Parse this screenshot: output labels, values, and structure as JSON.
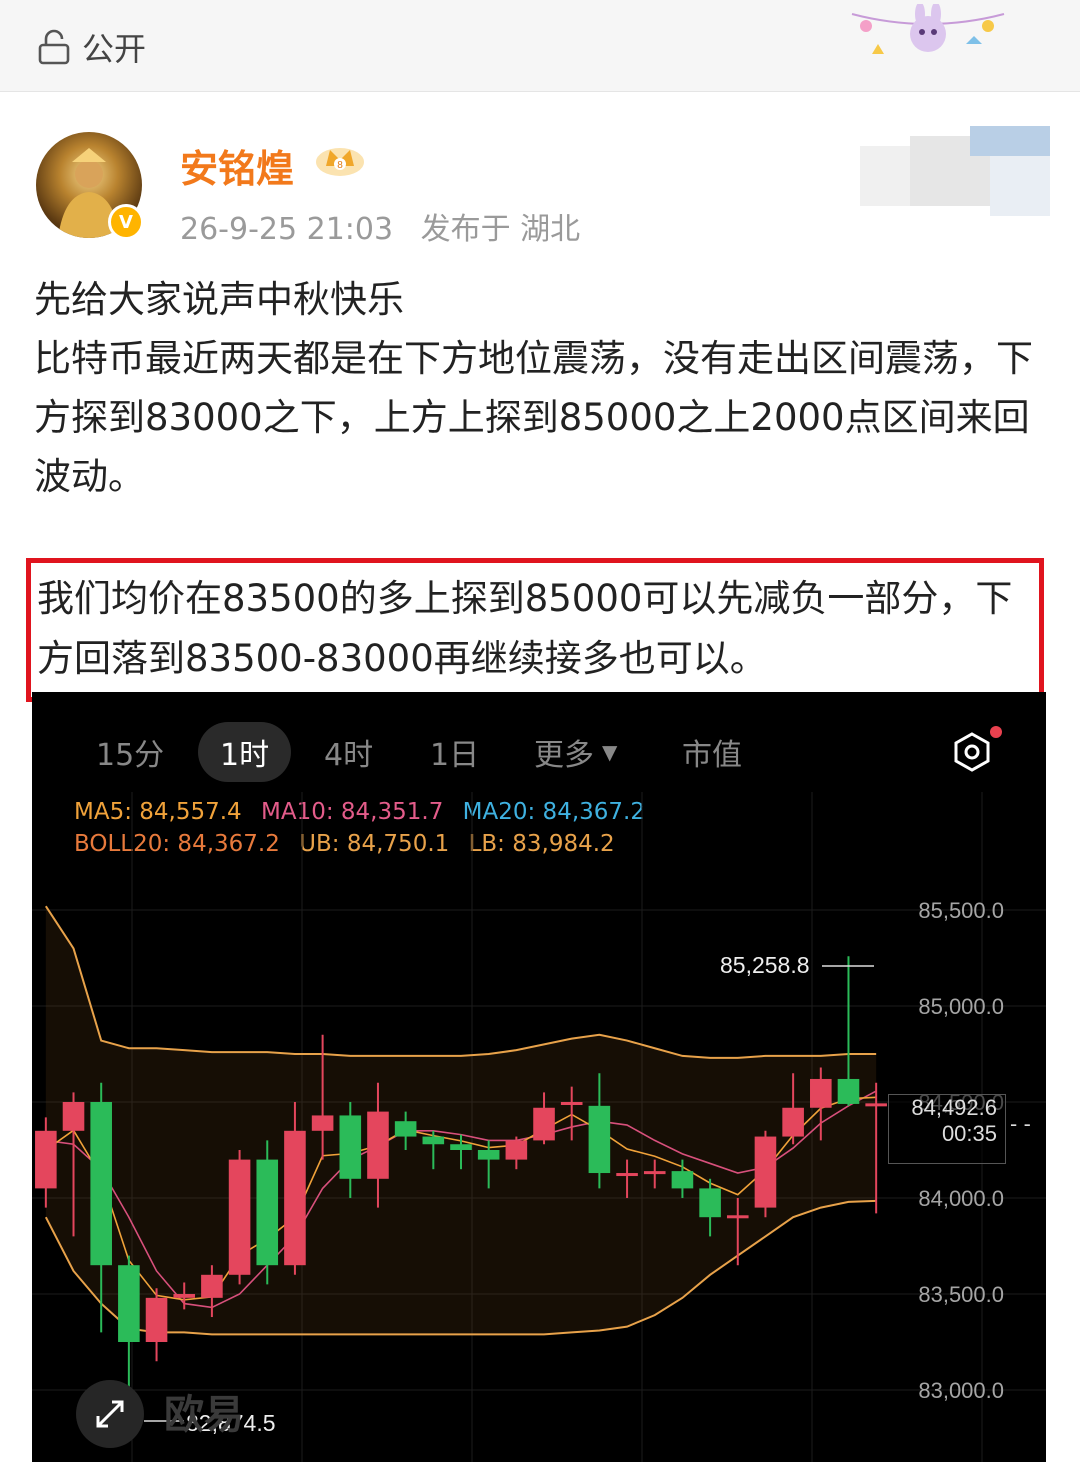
{
  "topbar": {
    "privacy_label": "公开"
  },
  "post": {
    "author": "安铭煌",
    "time": "26-9-25 21:03",
    "location": "发布于 湖北",
    "paragraphs": [
      "先给大家说声中秋快乐",
      "比特币最近两天都是在下方地位震荡，没有走出区间震荡，下方探到83000之下，上方上探到85000之上2000点区间来回波动。"
    ],
    "highlight": "我们均价在83500的多上探到85000可以先减负一部分，下方回落到83500-83000再继续接多也可以。"
  },
  "chart": {
    "tabs": [
      "15分",
      "1时",
      "4时",
      "1日",
      "更多",
      "市值"
    ],
    "active_tab": "1时",
    "indicators": {
      "ma5": "MA5: 84,557.4",
      "ma10": "MA10: 84,351.7",
      "ma20": "MA20: 84,367.2",
      "boll": "BOLL20: 84,367.2",
      "ub": "UB: 84,750.1",
      "lb": "LB: 83,984.2"
    },
    "high_label": "85,258.8",
    "low_label": "82,874.5",
    "current_price": "84,492.6",
    "countdown": "00:35",
    "watermark": "欧易",
    "colors": {
      "up": "#e4465d",
      "down": "#2bbb59",
      "ub": "#e8a24a",
      "lb": "#e8a24a",
      "ma": "#f0a23a"
    }
  },
  "chart_data": {
    "type": "candlestick",
    "y_ticks": [
      "85,500.0",
      "85,000.0",
      "84,500.0",
      "84,000.0",
      "83,500.0",
      "83,000.0"
    ],
    "ylim": [
      82800,
      85800
    ],
    "candles": [
      {
        "o": 84050,
        "c": 84350,
        "h": 84420,
        "l": 83950
      },
      {
        "o": 84350,
        "c": 84500,
        "h": 84550,
        "l": 83800
      },
      {
        "o": 84500,
        "c": 83650,
        "h": 84600,
        "l": 83300
      },
      {
        "o": 83650,
        "c": 83250,
        "h": 83700,
        "l": 82875
      },
      {
        "o": 83250,
        "c": 83480,
        "h": 83530,
        "l": 83150
      },
      {
        "o": 83480,
        "c": 83500,
        "h": 83560,
        "l": 83420
      },
      {
        "o": 83480,
        "c": 83600,
        "h": 83650,
        "l": 83380
      },
      {
        "o": 83600,
        "c": 84200,
        "h": 84250,
        "l": 83550
      },
      {
        "o": 84200,
        "c": 83650,
        "h": 84300,
        "l": 83550
      },
      {
        "o": 83650,
        "c": 84350,
        "h": 84500,
        "l": 83600
      },
      {
        "o": 84350,
        "c": 84430,
        "h": 84850,
        "l": 84200
      },
      {
        "o": 84430,
        "c": 84100,
        "h": 84500,
        "l": 84000
      },
      {
        "o": 84100,
        "c": 84450,
        "h": 84600,
        "l": 83950
      },
      {
        "o": 84400,
        "c": 84320,
        "h": 84450,
        "l": 84250
      },
      {
        "o": 84320,
        "c": 84280,
        "h": 84350,
        "l": 84150
      },
      {
        "o": 84280,
        "c": 84250,
        "h": 84330,
        "l": 84150
      },
      {
        "o": 84250,
        "c": 84200,
        "h": 84300,
        "l": 84050
      },
      {
        "o": 84200,
        "c": 84300,
        "h": 84320,
        "l": 84150
      },
      {
        "o": 84300,
        "c": 84470,
        "h": 84550,
        "l": 84280
      },
      {
        "o": 84500,
        "c": 84500,
        "h": 84580,
        "l": 84300
      },
      {
        "o": 84480,
        "c": 84130,
        "h": 84650,
        "l": 84050
      },
      {
        "o": 84130,
        "c": 84130,
        "h": 84200,
        "l": 84000
      },
      {
        "o": 84130,
        "c": 84140,
        "h": 84200,
        "l": 84050
      },
      {
        "o": 84140,
        "c": 84050,
        "h": 84200,
        "l": 84000
      },
      {
        "o": 84050,
        "c": 83900,
        "h": 84100,
        "l": 83800
      },
      {
        "o": 83900,
        "c": 83910,
        "h": 84000,
        "l": 83650
      },
      {
        "o": 83950,
        "c": 84320,
        "h": 84350,
        "l": 83900
      },
      {
        "o": 84320,
        "c": 84470,
        "h": 84650,
        "l": 84280
      },
      {
        "o": 84470,
        "c": 84620,
        "h": 84680,
        "l": 84300
      },
      {
        "o": 84620,
        "c": 84490,
        "h": 85259,
        "l": 84480
      },
      {
        "o": 84490,
        "c": 84493,
        "h": 84600,
        "l": 83920
      }
    ],
    "ub": [
      85520,
      85300,
      84820,
      84780,
      84780,
      84770,
      84760,
      84760,
      84760,
      84750,
      84750,
      84740,
      84740,
      84740,
      84740,
      84740,
      84750,
      84770,
      84800,
      84830,
      84850,
      84820,
      84780,
      84740,
      84730,
      84730,
      84740,
      84740,
      84740,
      84750,
      84750
    ],
    "lb": [
      83900,
      83620,
      83450,
      83320,
      83300,
      83300,
      83290,
      83290,
      83290,
      83290,
      83290,
      83290,
      83290,
      83290,
      83290,
      83290,
      83290,
      83290,
      83290,
      83300,
      83310,
      83330,
      83390,
      83480,
      83600,
      83700,
      83800,
      83900,
      83950,
      83980,
      83985
    ],
    "ma": [
      84300,
      84280,
      84150,
      83900,
      83620,
      83450,
      83430,
      83500,
      83650,
      83800,
      84050,
      84200,
      84270,
      84350,
      84350,
      84330,
      84300,
      84300,
      84330,
      84370,
      84400,
      84380,
      84300,
      84230,
      84180,
      84130,
      84160,
      84260,
      84390,
      84480,
      84557
    ]
  }
}
